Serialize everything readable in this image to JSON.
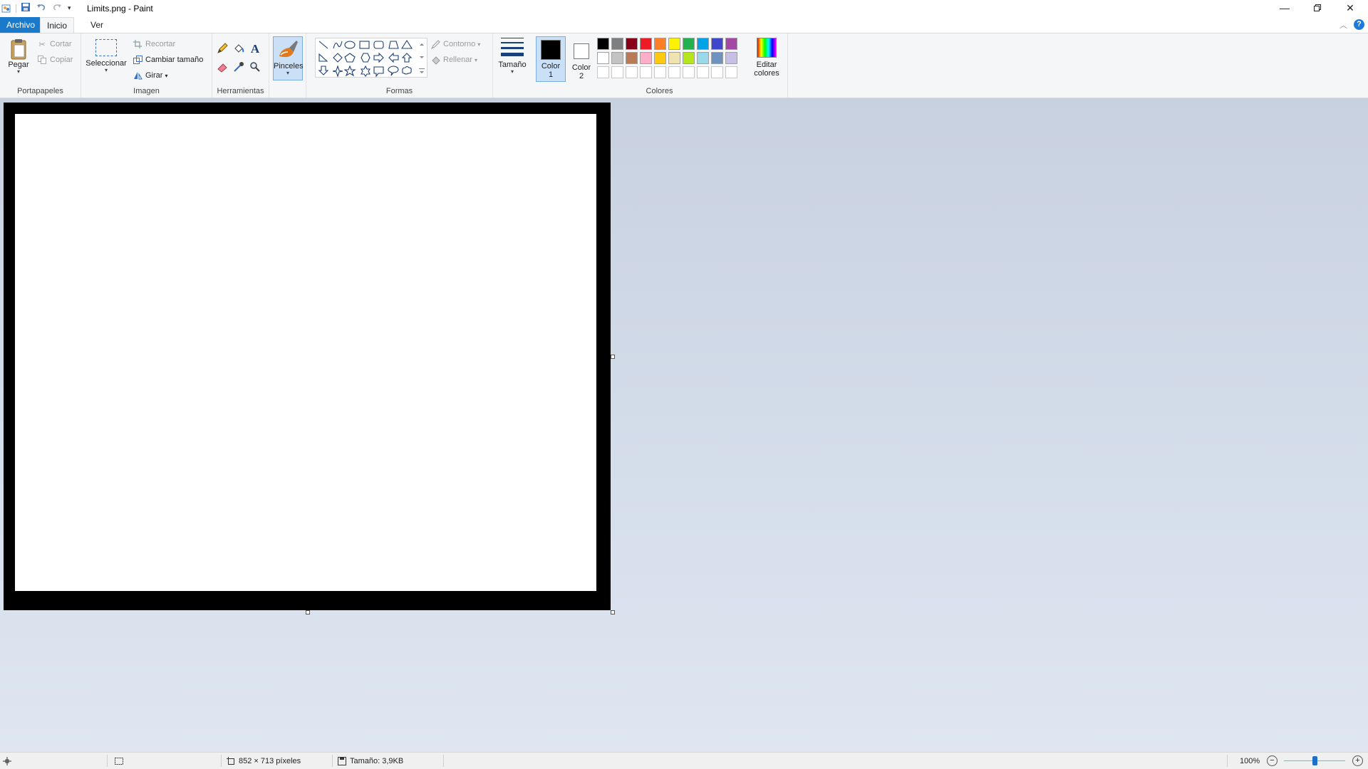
{
  "window": {
    "title": "Limits.png - Paint",
    "qat_icons": [
      "paint-app-icon",
      "save-icon",
      "undo-icon",
      "redo-icon",
      "customize-qat-icon"
    ],
    "controls": [
      "minimize-icon",
      "restore-icon",
      "close-icon"
    ]
  },
  "tabs": [
    {
      "label": "Archivo"
    },
    {
      "label": "Inicio"
    },
    {
      "label": "Ver"
    }
  ],
  "ribbon": {
    "clipboard": {
      "group_label": "Portapapeles",
      "paste": "Pegar",
      "cut": "Cortar",
      "copy": "Copiar"
    },
    "image": {
      "group_label": "Imagen",
      "select": "Seleccionar",
      "crop": "Recortar",
      "resize": "Cambiar tamaño",
      "rotate": "Girar"
    },
    "tools": {
      "group_label": "Herramientas",
      "items": [
        "pencil-icon",
        "fill-bucket-icon",
        "text-icon",
        "eraser-icon",
        "color-picker-icon",
        "magnifier-icon"
      ]
    },
    "brushes": {
      "label": "Pinceles"
    },
    "shapes": {
      "group_label": "Formas",
      "outline": "Contorno",
      "fill": "Rellenar"
    },
    "size": {
      "label": "Tamaño"
    },
    "colors": {
      "group_label": "Colores",
      "color1_line1": "Color",
      "color1_line2": "1",
      "color2_line1": "Color",
      "color2_line2": "2",
      "edit_line1": "Editar",
      "edit_line2": "colores",
      "color1": "#000000",
      "color2": "#ffffff",
      "palette_row1": [
        "#000000",
        "#7f7f7f",
        "#880015",
        "#ed1c24",
        "#ff7f27",
        "#fff200",
        "#22b14c",
        "#00a2e8",
        "#3f48cc",
        "#a349a4"
      ],
      "palette_row2": [
        "#ffffff",
        "#c3c3c3",
        "#b97a57",
        "#ffaec9",
        "#ffc90e",
        "#efe4b0",
        "#b5e61d",
        "#99d9ea",
        "#7092be",
        "#c8bfe7"
      ],
      "palette_row3_count": 10
    }
  },
  "statusbar": {
    "dimensions": "852 × 713 píxeles",
    "file_size": "Tamaño: 3,9KB",
    "zoom": "100%",
    "zoom_fraction": 0.5
  }
}
